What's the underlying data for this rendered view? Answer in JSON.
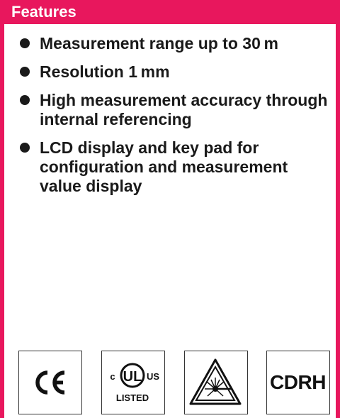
{
  "header": {
    "title": "Features"
  },
  "features": [
    "Measurement range up to 30 m",
    "Resolution 1 mm",
    "High measurement accuracy through internal referencing",
    "LCD display and key pad for configuration and measurement value display"
  ],
  "logos": {
    "ce": "CE",
    "ul_left": "c",
    "ul_center": "UL",
    "ul_right": "US",
    "ul_bottom": "LISTED",
    "laser_icon": "laser-warning-icon",
    "cdrh": "CDRH"
  },
  "colors": {
    "accent": "#E8175D",
    "text": "#1a1a1a"
  }
}
